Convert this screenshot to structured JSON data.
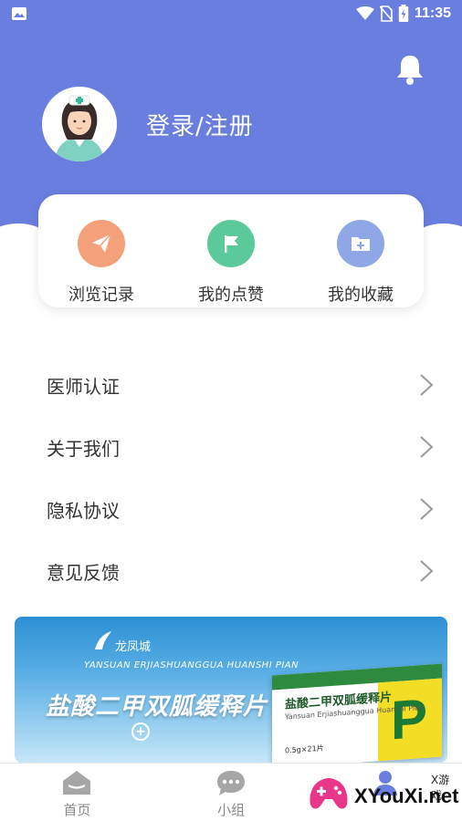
{
  "status_bar": {
    "time": "11:35",
    "icons": [
      "image-icon",
      "wifi-icon",
      "no-sim-icon",
      "battery-charging-icon"
    ]
  },
  "header": {
    "login_label": "登录/注册",
    "bell_icon": "bell-icon",
    "avatar_icon": "nurse-avatar"
  },
  "quick_actions": [
    {
      "label": "浏览记录",
      "icon": "paper-plane-icon",
      "color": "#f4a07a"
    },
    {
      "label": "我的点赞",
      "icon": "flag-icon",
      "color": "#5cc99a"
    },
    {
      "label": "我的收藏",
      "icon": "folder-plus-icon",
      "color": "#8fa7e6"
    }
  ],
  "menu": [
    {
      "label": "医师认证"
    },
    {
      "label": "关于我们"
    },
    {
      "label": "隐私协议"
    },
    {
      "label": "意见反馈"
    }
  ],
  "banner": {
    "brand": "龙凤城",
    "subtitle": "YANSUAN ERJIASHUANGGUA HUANSHI PIAN",
    "title": "盐酸二甲双胍缓释片",
    "box_name": "盐酸二甲双胍缓释片",
    "box_sub": "Yansuan Erjiashuanggua Huanshi Pian",
    "box_dose": "0.5g×21片",
    "box_letter": "P"
  },
  "bottom_nav": [
    {
      "label": "首页",
      "icon": "home-icon"
    },
    {
      "label": "小组",
      "icon": "chat-bubble-icon"
    },
    {
      "label": "",
      "icon": "profile-icon"
    }
  ],
  "watermark": {
    "tag": "X游戏",
    "site": "XYouXi.net"
  },
  "colors": {
    "primary": "#6a7ee0",
    "orange": "#f4a07a",
    "green": "#5cc99a",
    "blue": "#8fa7e6"
  }
}
